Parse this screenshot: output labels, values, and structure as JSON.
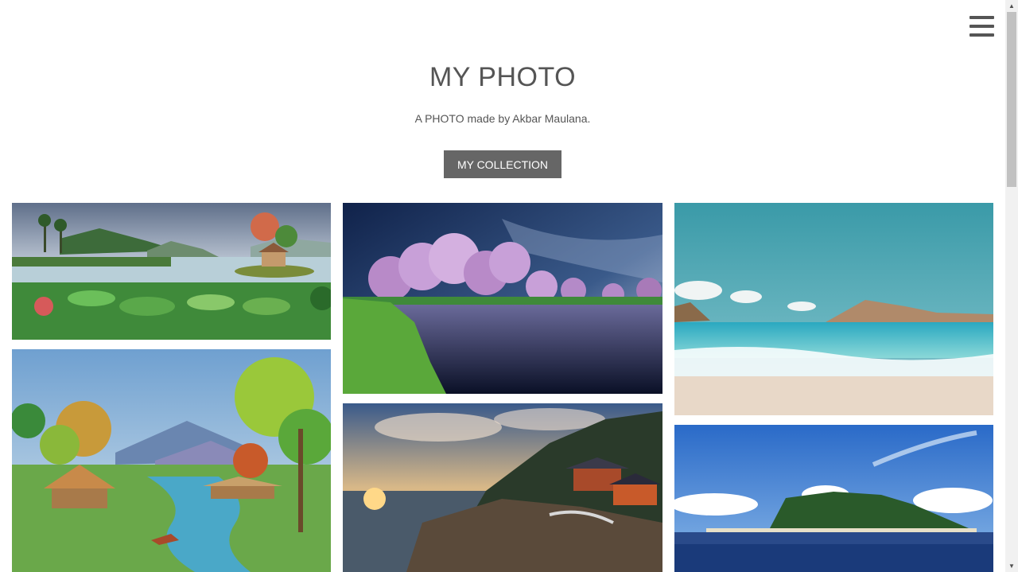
{
  "header": {
    "menu_icon": "hamburger-menu-icon",
    "title": "MY PHOTO",
    "subtitle": "A PHOTO made by Akbar Maulana.",
    "button_label": "MY COLLECTION"
  },
  "colors": {
    "text": "#555555",
    "button_bg": "#666666",
    "button_text": "#ffffff"
  },
  "scrollbar": {
    "up_arrow": "▲",
    "down_arrow": "▼"
  }
}
